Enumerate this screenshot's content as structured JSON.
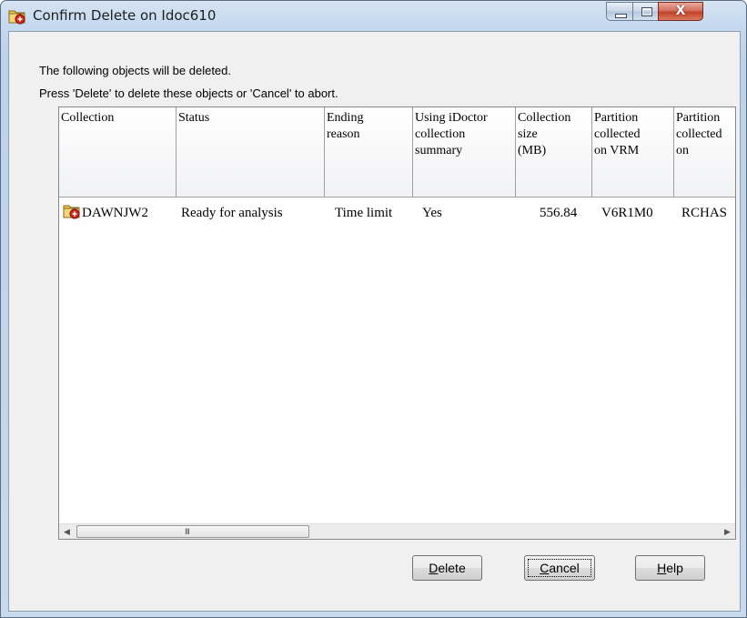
{
  "window": {
    "title": "Confirm Delete on Idoc610",
    "close_label": "X"
  },
  "message": {
    "line1": "The following objects will be deleted.",
    "line2": "Press 'Delete' to delete these objects or 'Cancel' to abort."
  },
  "list": {
    "columns": [
      "Collection",
      "Status",
      "Ending\nreason",
      "Using iDoctor\ncollection\nsummary",
      "Collection\nsize\n(MB)",
      "Partition\ncollected\non VRM",
      "Partition\ncollected\non"
    ],
    "rows": [
      {
        "collection": "DAWNJW2",
        "status": "Ready for analysis",
        "ending_reason": "Time limit",
        "using_idoctor": "Yes",
        "size_mb": "556.84",
        "vrm": "V6R1M0",
        "collected_on": "RCHAS"
      }
    ],
    "scroll_grip": "III"
  },
  "buttons": {
    "delete": {
      "accel": "D",
      "rest": "elete"
    },
    "cancel": {
      "accel": "C",
      "rest": "ancel"
    },
    "help": {
      "accel": "H",
      "rest": "elp"
    }
  },
  "icons": {
    "title_icon": "folder-delete-icon",
    "row_icon": "folder-delete-icon"
  }
}
